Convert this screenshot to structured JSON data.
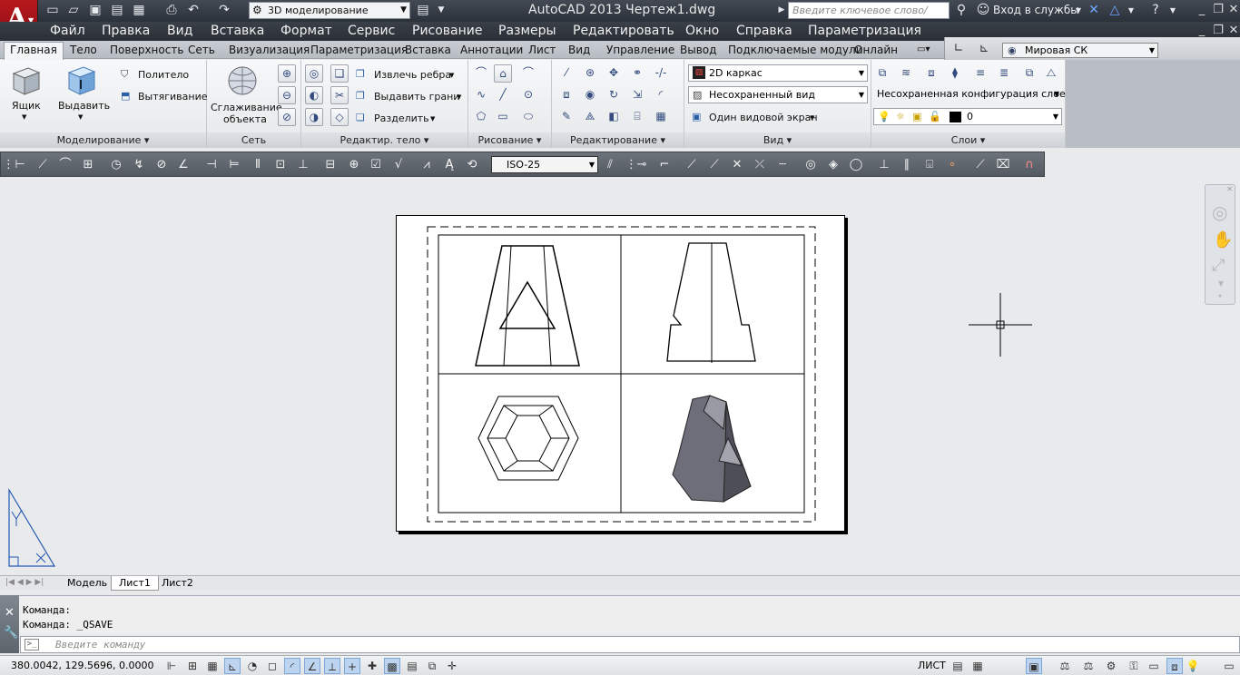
{
  "window": {
    "title": "AutoCAD 2013    Чертеж1.dwg",
    "workspace": "3D моделирование",
    "search_placeholder": "Введите ключевое слово/фразу",
    "signin": "Вход в службы"
  },
  "menu": [
    "Файл",
    "Правка",
    "Вид",
    "Вставка",
    "Формат",
    "Сервис",
    "Рисование",
    "Размеры",
    "Редактировать",
    "Окно",
    "Справка",
    "Параметризация"
  ],
  "ribbon_tabs": [
    "Главная",
    "Тело",
    "Поверхность",
    "Сеть",
    "Визуализация",
    "Параметризация",
    "Вставка",
    "Аннотации",
    "Лист",
    "Вид",
    "Управление",
    "Вывод",
    "Подключаемые модули",
    "Онлайн"
  ],
  "ucs": "Мировая СК",
  "panels": {
    "modeling": {
      "title": "Моделирование",
      "box": "Ящик",
      "extrude": "Выдавить",
      "polysolid": "Политело",
      "presspull": "Вытягивание"
    },
    "mesh": {
      "title": "Сеть",
      "smooth_line1": "Сглаживание",
      "smooth_line2": "объекта"
    },
    "solid_edit": {
      "title": "Редактир. тело",
      "extract_edges": "Извлечь ребра",
      "extrude_faces": "Выдавить грани",
      "separate": "Разделить"
    },
    "draw": {
      "title": "Рисование"
    },
    "modify": {
      "title": "Редактирование"
    },
    "view": {
      "title": "Вид",
      "visual_style": "2D каркас",
      "named_view": "Несохраненный вид",
      "viewport": "Один видовой экран"
    },
    "layers": {
      "title": "Слои",
      "layer_state": "Несохраненная конфигурация слоев",
      "current_layer": "0"
    }
  },
  "toolbar": {
    "dimstyle": "ISO-25"
  },
  "layout_tabs": [
    "Модель",
    "Лист1",
    "Лист2"
  ],
  "active_layout": "Лист1",
  "command": {
    "history": [
      "Команда:",
      "Команда:  _QSAVE"
    ],
    "placeholder": "Введите команду"
  },
  "status": {
    "coords": "380.0042, 129.5696, 0.0000",
    "space": "ЛИСТ"
  },
  "colors": {
    "accent": "#c4161c",
    "title_bg": "#2f353d",
    "ribbon_bg": "#eceef0"
  },
  "icons": [
    "app-menu-icon",
    "new-icon",
    "open-icon",
    "save-icon",
    "saveas-icon",
    "plot-icon",
    "print-icon",
    "undo-icon",
    "redo-icon",
    "binoculars-icon",
    "user-icon",
    "exchange-icon",
    "help-icon"
  ]
}
